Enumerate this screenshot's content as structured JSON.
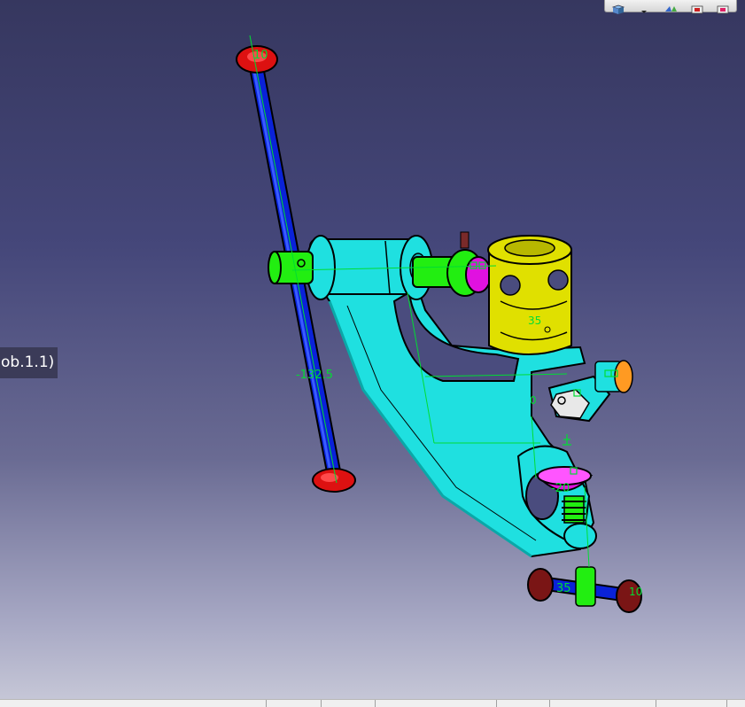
{
  "viewer": {
    "spec_tag": "ob.1.1)"
  },
  "dimensions": {
    "top_bolt": "10",
    "tie_rod_length": "-132.5",
    "bushing": "35",
    "knuckle_angle": "0",
    "ball_joint": "-20",
    "lower_link": "35",
    "right_end": "10"
  },
  "toolbar": {
    "icons": [
      "view-cube-icon",
      "dropdown-arrow-icon",
      "render-style-icon",
      "hide-show-icon",
      "swap-space-icon"
    ]
  },
  "colors": {
    "background_top": "#36375f",
    "arm_cyan": "#1fe0e0",
    "pin_green": "#22ee11",
    "rod_blue": "#0a22d8",
    "bushing_yellow": "#e0e000",
    "cap_red": "#dd1111",
    "joint_magenta": "#e011e0",
    "dimension_green": "#00dd33"
  }
}
